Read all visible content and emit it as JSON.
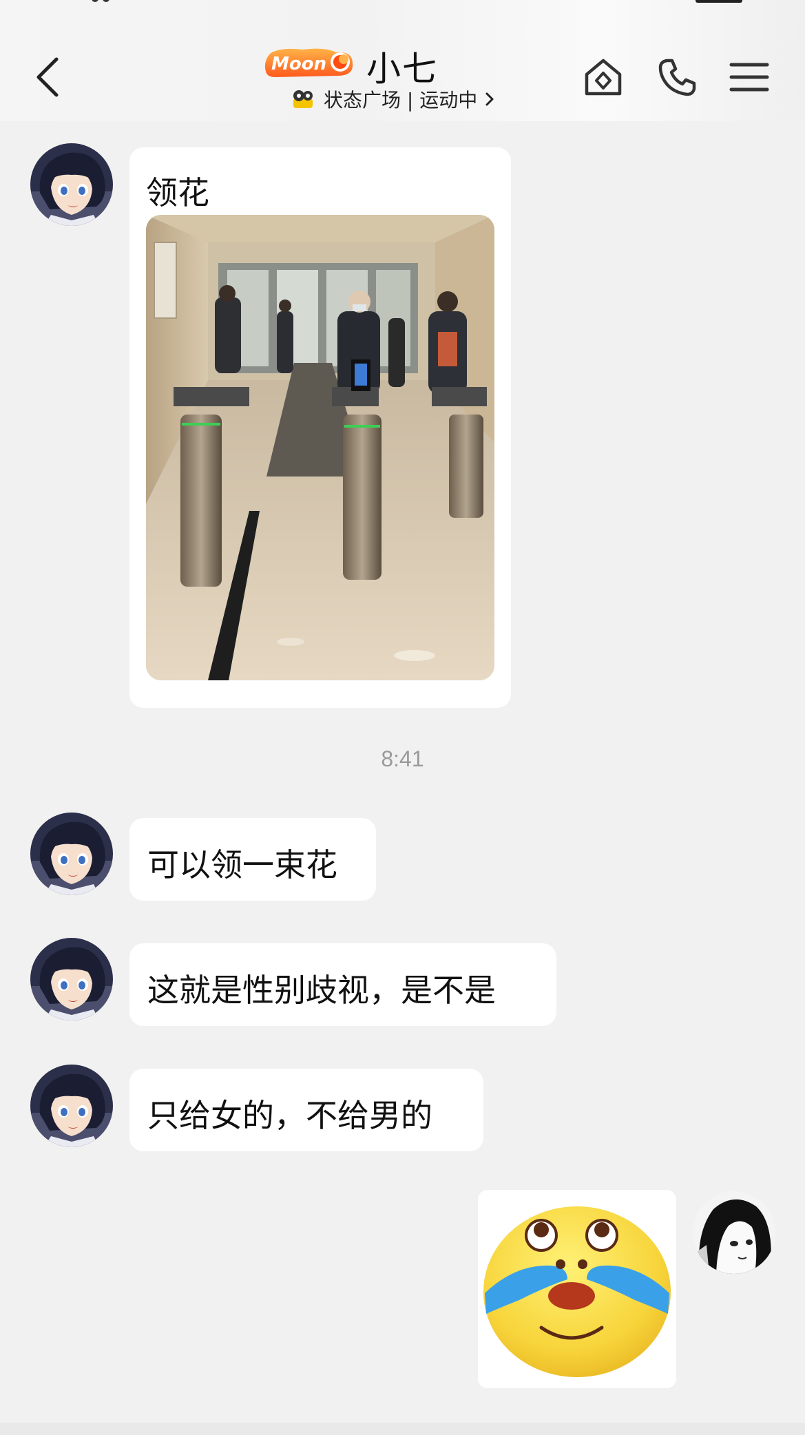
{
  "header": {
    "title": "小七",
    "badge_text": "Moon",
    "subtitle": "状态广场 | 运动中",
    "icons": {
      "back": "chevron-left-icon",
      "home": "home-diamond-icon",
      "call": "phone-icon",
      "menu": "hamburger-menu-icon"
    }
  },
  "messages": [
    {
      "sender": "contact",
      "type": "text-with-image",
      "text": "领花",
      "image": "photo-office-turnstiles"
    },
    {
      "type": "timestamp",
      "text": "8:41"
    },
    {
      "sender": "contact",
      "type": "text",
      "text": "可以领一束花"
    },
    {
      "sender": "contact",
      "type": "text",
      "text": "这就是性别歧视，是不是"
    },
    {
      "sender": "contact",
      "type": "text",
      "text": "只给女的，不给男的"
    },
    {
      "sender": "me",
      "type": "sticker",
      "sticker": "crying-laughing-face-sticker"
    }
  ],
  "colors": {
    "background": "#f1f1f1",
    "bubble": "#ffffff",
    "timestamp": "#9a9a9a",
    "badge": "#ff7a1a"
  }
}
